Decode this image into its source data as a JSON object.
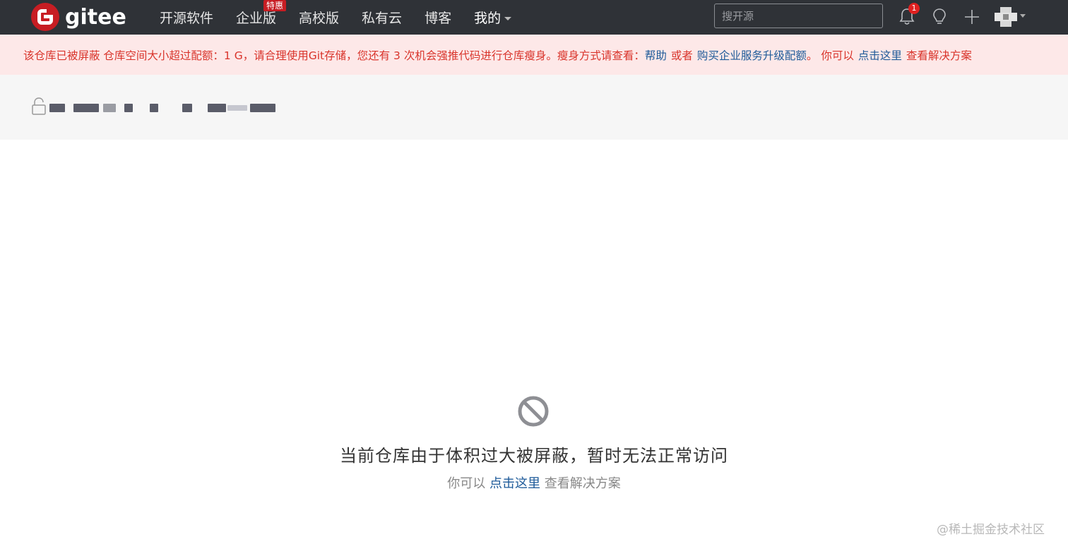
{
  "navbar": {
    "logo_text": "gitee",
    "items": [
      {
        "label": "开源软件"
      },
      {
        "label": "企业版",
        "badge": "特惠"
      },
      {
        "label": "高校版"
      },
      {
        "label": "私有云"
      },
      {
        "label": "博客"
      },
      {
        "label": "我的"
      }
    ],
    "search_placeholder": "搜开源",
    "notification_count": "1"
  },
  "banner": {
    "text1": "该仓库已被屏蔽 仓库空间大小超过配额：1 G，请合理使用Git存储，您还有 3 次机会强推代码进行仓库瘦身。瘦身方式请查看：",
    "link_help": "帮助",
    "text2": "或者",
    "link_upgrade": "购买企业服务升级配额",
    "text3": "。 你可以",
    "link_here": "点击这里",
    "text4": "查看解决方案"
  },
  "blocked": {
    "title": "当前仓库由于体积过大被屏蔽，暂时无法正常访问",
    "sub_prefix": "你可以",
    "sub_link": "点击这里",
    "sub_suffix": "查看解决方案"
  },
  "watermark": "@稀土掘金技术社区",
  "colors": {
    "navbar_bg": "#2f3237",
    "brand_red": "#c71d23",
    "banner_bg": "#fde8e8",
    "banner_text": "#d9342b",
    "link": "#1d5a99"
  }
}
